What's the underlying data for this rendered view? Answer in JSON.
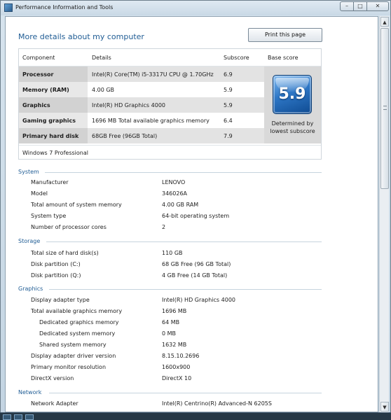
{
  "window": {
    "title": "Performance Information and Tools",
    "min": "–",
    "max": "□",
    "close": "✕"
  },
  "page": {
    "title": "More details about my computer",
    "print_button": "Print this page"
  },
  "score_table": {
    "headers": {
      "component": "Component",
      "details": "Details",
      "subscore": "Subscore",
      "base": "Base score"
    },
    "rows": [
      {
        "component": "Processor",
        "details": "Intel(R) Core(TM) i5-3317U CPU @ 1.70GHz",
        "subscore": "6.9"
      },
      {
        "component": "Memory (RAM)",
        "details": "4.00 GB",
        "subscore": "5.9"
      },
      {
        "component": "Graphics",
        "details": "Intel(R) HD Graphics 4000",
        "subscore": "5.9"
      },
      {
        "component": "Gaming graphics",
        "details": "1696 MB Total available graphics memory",
        "subscore": "6.4"
      },
      {
        "component": "Primary hard disk",
        "details": "68GB Free (96GB Total)",
        "subscore": "7.9"
      }
    ],
    "base_score": "5.9",
    "base_caption": "Determined by lowest subscore",
    "os": "Windows 7 Professional"
  },
  "sections": {
    "system": {
      "title": "System",
      "rows": [
        {
          "label": "Manufacturer",
          "value": "LENOVO"
        },
        {
          "label": "Model",
          "value": "346026A"
        },
        {
          "label": "Total amount of system memory",
          "value": "4.00 GB RAM"
        },
        {
          "label": "System type",
          "value": "64-bit operating system"
        },
        {
          "label": "Number of processor cores",
          "value": "2"
        }
      ]
    },
    "storage": {
      "title": "Storage",
      "rows": [
        {
          "label": "Total size of hard disk(s)",
          "value": "110 GB"
        },
        {
          "label": "Disk partition (C:)",
          "value": "68 GB Free (96 GB Total)"
        },
        {
          "label": "Disk partition (Q:)",
          "value": "4 GB Free (14 GB Total)"
        }
      ]
    },
    "graphics": {
      "title": "Graphics",
      "rows": [
        {
          "label": "Display adapter type",
          "value": "Intel(R) HD Graphics 4000"
        },
        {
          "label": "Total available graphics memory",
          "value": "1696 MB"
        },
        {
          "label": "Dedicated graphics memory",
          "value": "64 MB"
        },
        {
          "label": "Dedicated system memory",
          "value": "0 MB"
        },
        {
          "label": "Shared system memory",
          "value": "1632 MB"
        },
        {
          "label": "Display adapter driver version",
          "value": "8.15.10.2696"
        },
        {
          "label": "Primary monitor resolution",
          "value": "1600x900"
        },
        {
          "label": "DirectX version",
          "value": "DirectX 10"
        }
      ]
    },
    "network": {
      "title": "Network",
      "rows": [
        {
          "label": "Network Adapter",
          "value": "Intel(R) Centrino(R) Advanced-N 6205S"
        }
      ]
    }
  },
  "scrollbar": {
    "up": "▲",
    "down": "▼"
  },
  "colors": {
    "link_blue": "#1f5c94",
    "badge_blue": "#2e77c6"
  }
}
